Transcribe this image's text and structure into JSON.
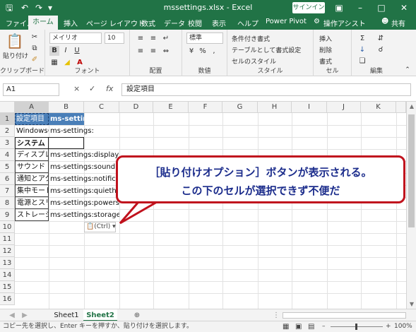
{
  "titlebar": {
    "title": "mssettings.xlsx  -  Excel",
    "signin": "サインイン",
    "save_icon": "save-icon",
    "undo_icon": "undo-icon",
    "redo_icon": "redo-icon"
  },
  "menu": {
    "items": [
      "ファイル",
      "ホーム",
      "挿入",
      "ページ レイアウト",
      "数式",
      "データ",
      "校閲",
      "表示",
      "ヘルプ",
      "Power Pivot",
      "操作アシスト",
      "共有"
    ]
  },
  "ribbon": {
    "paste": "貼り付け",
    "font_name": "メイリオ",
    "font_size": "10",
    "bold": "B",
    "italic": "I",
    "underline": "U",
    "number_format": "標準",
    "cond_format": "条件付き書式",
    "table_format": "テーブルとして書式設定",
    "cell_style": "セルのスタイル",
    "insert": "挿入",
    "delete": "削除",
    "format": "書式",
    "groups": [
      "クリップボード",
      "フォント",
      "配置",
      "数値",
      "スタイル",
      "セル",
      "編集"
    ]
  },
  "formula_bar": {
    "name_box": "A1",
    "cancel": "×",
    "confirm": "✓",
    "fx": "fx",
    "value": "設定項目"
  },
  "grid": {
    "columns": [
      "A",
      "B",
      "C",
      "D",
      "E",
      "F",
      "G",
      "H",
      "I",
      "J",
      "K"
    ],
    "rows": [
      "1",
      "2",
      "3",
      "4",
      "5",
      "6",
      "7",
      "8",
      "9",
      "10",
      "11",
      "12",
      "13",
      "14",
      "15",
      "16"
    ],
    "cells": [
      {
        "a": "設定項目",
        "b": "ms-settings"
      },
      {
        "a": "Windowsの",
        "b": "ms-settings:"
      },
      {
        "a": "システム",
        "b": ""
      },
      {
        "a": "ディスプレイ",
        "b": "ms-settings:display"
      },
      {
        "a": "サウンド",
        "b": "ms-settings:sound"
      },
      {
        "a": "通知とアクシ",
        "b": "ms-settings:notifications"
      },
      {
        "a": "集中モード",
        "b": "ms-settings:quiethours"
      },
      {
        "a": "電源とスリー",
        "b": "ms-settings:powersleep"
      },
      {
        "a": "ストレージ",
        "b": "ms-settings:storagesense"
      }
    ],
    "paste_options": "(Ctrl)"
  },
  "sheets": {
    "tabs": [
      "Sheet1",
      "Sheet2"
    ],
    "active": "Sheet2"
  },
  "status": {
    "message": "コピー先を選択し、Enter キーを押すか、貼り付けを選択します。",
    "zoom": "100%"
  },
  "callout": {
    "line1": "［貼り付けオプション］ボタンが表示される。",
    "line2": "この下のセルが選択できず不便だ"
  },
  "colors": {
    "excel_green": "#217346",
    "header_fill": "#4a7fb8",
    "callout_border": "#c0121d",
    "callout_text": "#1c2d8c"
  }
}
